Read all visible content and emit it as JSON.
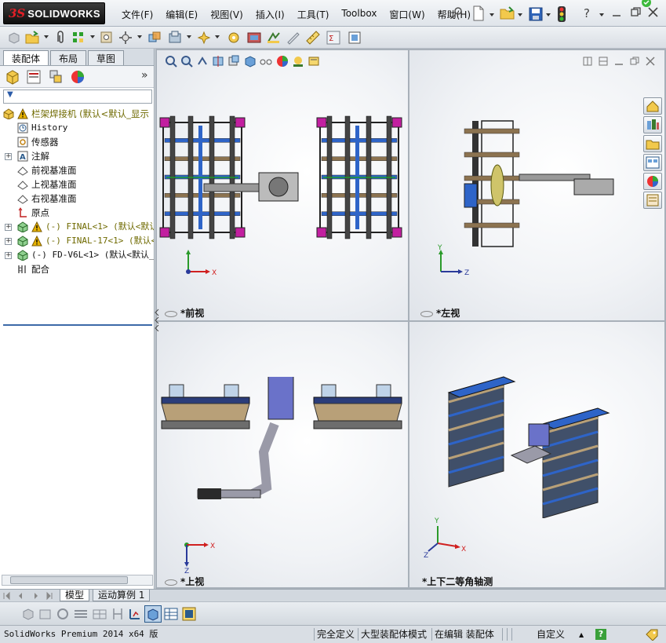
{
  "app": {
    "brand": "SOLIDWORKS",
    "brand_prefix": "3S"
  },
  "menus": [
    "文件(F)",
    "编辑(E)",
    "视图(V)",
    "插入(I)",
    "工具(T)",
    "Toolbox",
    "窗口(W)",
    "帮助(H)"
  ],
  "left_panel": {
    "tabs": [
      "装配体",
      "布局",
      "草图"
    ],
    "expand_glyph": "»",
    "filter_glyph": "▼",
    "tree": [
      {
        "label": "栏架焊接机  (默认<默认_显示",
        "icon": "assembly-icon",
        "warning": true,
        "expander": "",
        "indent": 0
      },
      {
        "label": "History",
        "icon": "history-icon",
        "warning": false,
        "expander": "",
        "indent": 1,
        "mono": true
      },
      {
        "label": "传感器",
        "icon": "sensor-icon",
        "warning": false,
        "expander": "",
        "indent": 1
      },
      {
        "label": "注解",
        "icon": "annotation-icon",
        "warning": false,
        "expander": "+",
        "indent": 1
      },
      {
        "label": "前视基准面",
        "icon": "plane-icon",
        "warning": false,
        "expander": "",
        "indent": 1
      },
      {
        "label": "上视基准面",
        "icon": "plane-icon",
        "warning": false,
        "expander": "",
        "indent": 1
      },
      {
        "label": "右视基准面",
        "icon": "plane-icon",
        "warning": false,
        "expander": "",
        "indent": 1
      },
      {
        "label": "原点",
        "icon": "origin-icon",
        "warning": false,
        "expander": "",
        "indent": 1
      },
      {
        "label": "(-) FINAL<1> (默认<默认",
        "icon": "subassembly-icon",
        "warning": true,
        "expander": "+",
        "indent": 1,
        "mono": true
      },
      {
        "label": "(-) FINAL-17<1> (默认<",
        "icon": "subassembly-icon",
        "warning": true,
        "expander": "+",
        "indent": 1,
        "mono": true
      },
      {
        "label": "(-) FD-V6L<1> (默认<默认_显",
        "icon": "subassembly-icon",
        "warning": false,
        "expander": "+",
        "indent": 1,
        "mono": true
      },
      {
        "label": "配合",
        "icon": "mates-icon",
        "warning": false,
        "expander": "",
        "indent": 1
      }
    ]
  },
  "viewports": [
    {
      "label": "*前视",
      "axes": [
        "Y",
        "X"
      ]
    },
    {
      "label": "*左视",
      "axes": [
        "Y",
        "Z"
      ]
    },
    {
      "label": "*上视",
      "axes": [
        "X",
        "Z"
      ]
    },
    {
      "label": "*上下二等角轴测",
      "axes": [
        "Y",
        "X",
        "Z"
      ]
    }
  ],
  "bottom_tabs": [
    "模型",
    "运动算例 1"
  ],
  "status": {
    "product": "SolidWorks Premium 2014 x64 版",
    "definition": "完全定义",
    "mode": "大型装配体模式",
    "editing": "在编辑 装配体",
    "units": "自定义",
    "units_arrow": "▲",
    "help": "?"
  },
  "colors": {
    "accent": "#3d6aa8",
    "warning": "#e8b400",
    "frame_blue": "#2e64c8",
    "frame_brown": "#8c7350",
    "frame_magenta": "#c21fa0",
    "frame_green": "#1c9a2a"
  }
}
